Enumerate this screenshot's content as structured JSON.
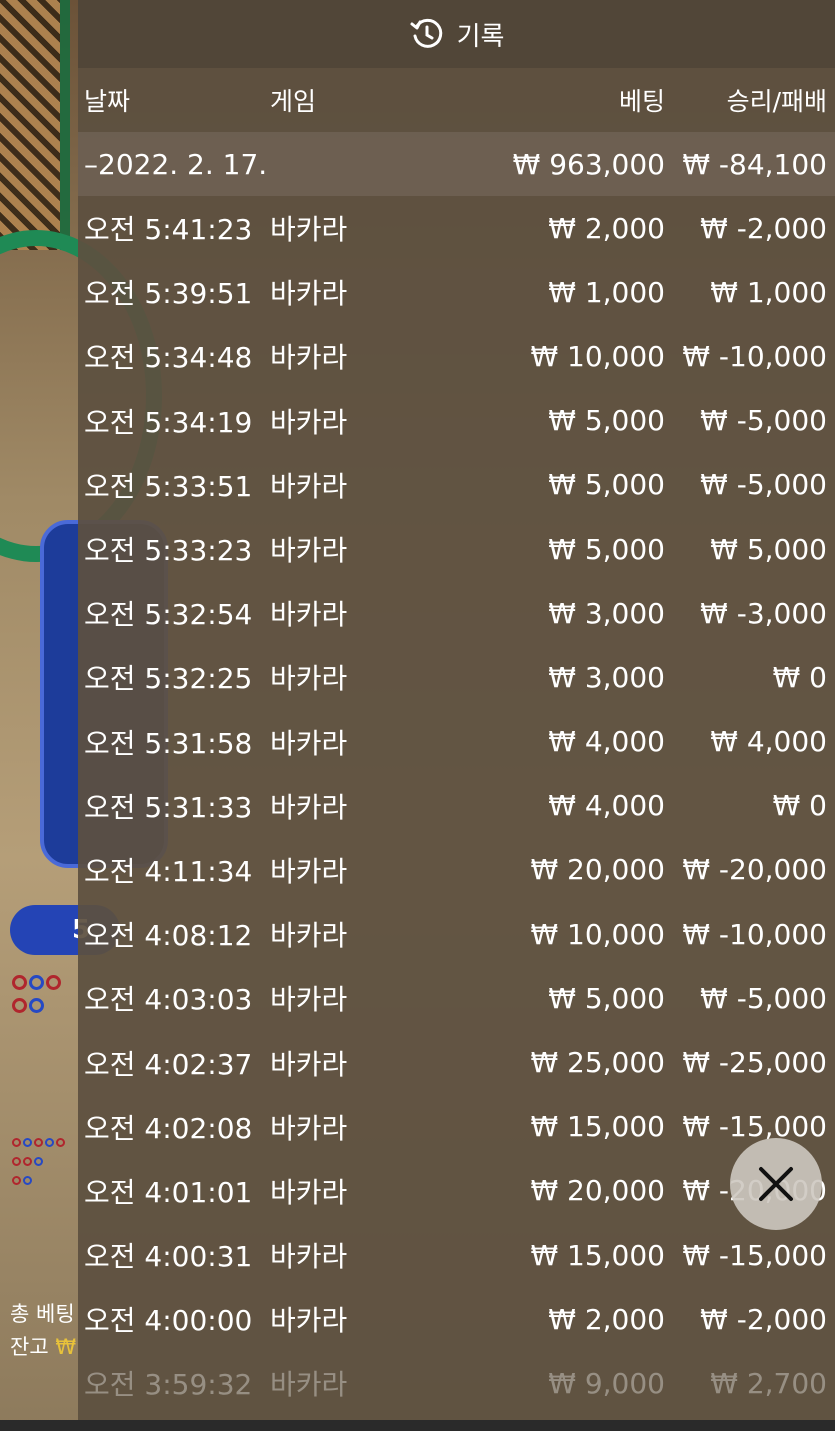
{
  "header": {
    "title": "기록"
  },
  "columns": {
    "date": "날짜",
    "game": "게임",
    "bet": "베팅",
    "result": "승리/패배"
  },
  "summary": {
    "date": "–2022. 2. 17.",
    "bet": "₩ 963,000",
    "result": "₩ -84,100"
  },
  "rows": [
    {
      "time": "오전 5:41:23",
      "game": "바카라",
      "bet": "₩ 2,000",
      "result": "₩ -2,000"
    },
    {
      "time": "오전 5:39:51",
      "game": "바카라",
      "bet": "₩ 1,000",
      "result": "₩ 1,000"
    },
    {
      "time": "오전 5:34:48",
      "game": "바카라",
      "bet": "₩ 10,000",
      "result": "₩ -10,000"
    },
    {
      "time": "오전 5:34:19",
      "game": "바카라",
      "bet": "₩ 5,000",
      "result": "₩ -5,000"
    },
    {
      "time": "오전 5:33:51",
      "game": "바카라",
      "bet": "₩ 5,000",
      "result": "₩ -5,000"
    },
    {
      "time": "오전 5:33:23",
      "game": "바카라",
      "bet": "₩ 5,000",
      "result": "₩ 5,000"
    },
    {
      "time": "오전 5:32:54",
      "game": "바카라",
      "bet": "₩ 3,000",
      "result": "₩ -3,000"
    },
    {
      "time": "오전 5:32:25",
      "game": "바카라",
      "bet": "₩ 3,000",
      "result": "₩ 0"
    },
    {
      "time": "오전 5:31:58",
      "game": "바카라",
      "bet": "₩ 4,000",
      "result": "₩ 4,000"
    },
    {
      "time": "오전 5:31:33",
      "game": "바카라",
      "bet": "₩ 4,000",
      "result": "₩ 0"
    },
    {
      "time": "오전 4:11:34",
      "game": "바카라",
      "bet": "₩ 20,000",
      "result": "₩ -20,000"
    },
    {
      "time": "오전 4:08:12",
      "game": "바카라",
      "bet": "₩ 10,000",
      "result": "₩ -10,000"
    },
    {
      "time": "오전 4:03:03",
      "game": "바카라",
      "bet": "₩ 5,000",
      "result": "₩ -5,000"
    },
    {
      "time": "오전 4:02:37",
      "game": "바카라",
      "bet": "₩ 25,000",
      "result": "₩ -25,000"
    },
    {
      "time": "오전 4:02:08",
      "game": "바카라",
      "bet": "₩ 15,000",
      "result": "₩ -15,000"
    },
    {
      "time": "오전 4:01:01",
      "game": "바카라",
      "bet": "₩ 20,000",
      "result": "₩ -20,000"
    },
    {
      "time": "오전 4:00:31",
      "game": "바카라",
      "bet": "₩ 15,000",
      "result": "₩ -15,000"
    },
    {
      "time": "오전 4:00:00",
      "game": "바카라",
      "bet": "₩ 2,000",
      "result": "₩ -2,000"
    },
    {
      "time": "오전 3:59:32",
      "game": "바카라",
      "bet": "₩ 9,000",
      "result": "₩ 2,700"
    }
  ],
  "background": {
    "pill_text": "5",
    "total_bet_label": "총 베팅",
    "balance_label": "잔고",
    "balance_prefix": "₩"
  },
  "icons": {
    "history": "history-clock-icon",
    "close": "close-icon"
  }
}
